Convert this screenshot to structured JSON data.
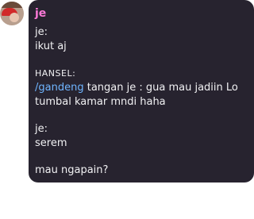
{
  "message": {
    "author": "je",
    "lines": {
      "l1": "je:",
      "l2": "ikut aj",
      "l3": "HANSEL:",
      "l4_command": "/gandeng",
      "l4_rest": " tangan je : gua mau jadiin Lo",
      "l5": "tumbal kamar mndi haha",
      "l6": "je:",
      "l7": "serem",
      "l8": "mau ngapain?"
    }
  },
  "colors": {
    "bubble_bg": "#27232f",
    "author_color": "#ff7ad9",
    "command_color": "#6fb5ff"
  },
  "icons": {
    "avatar": "user-avatar-icon"
  }
}
